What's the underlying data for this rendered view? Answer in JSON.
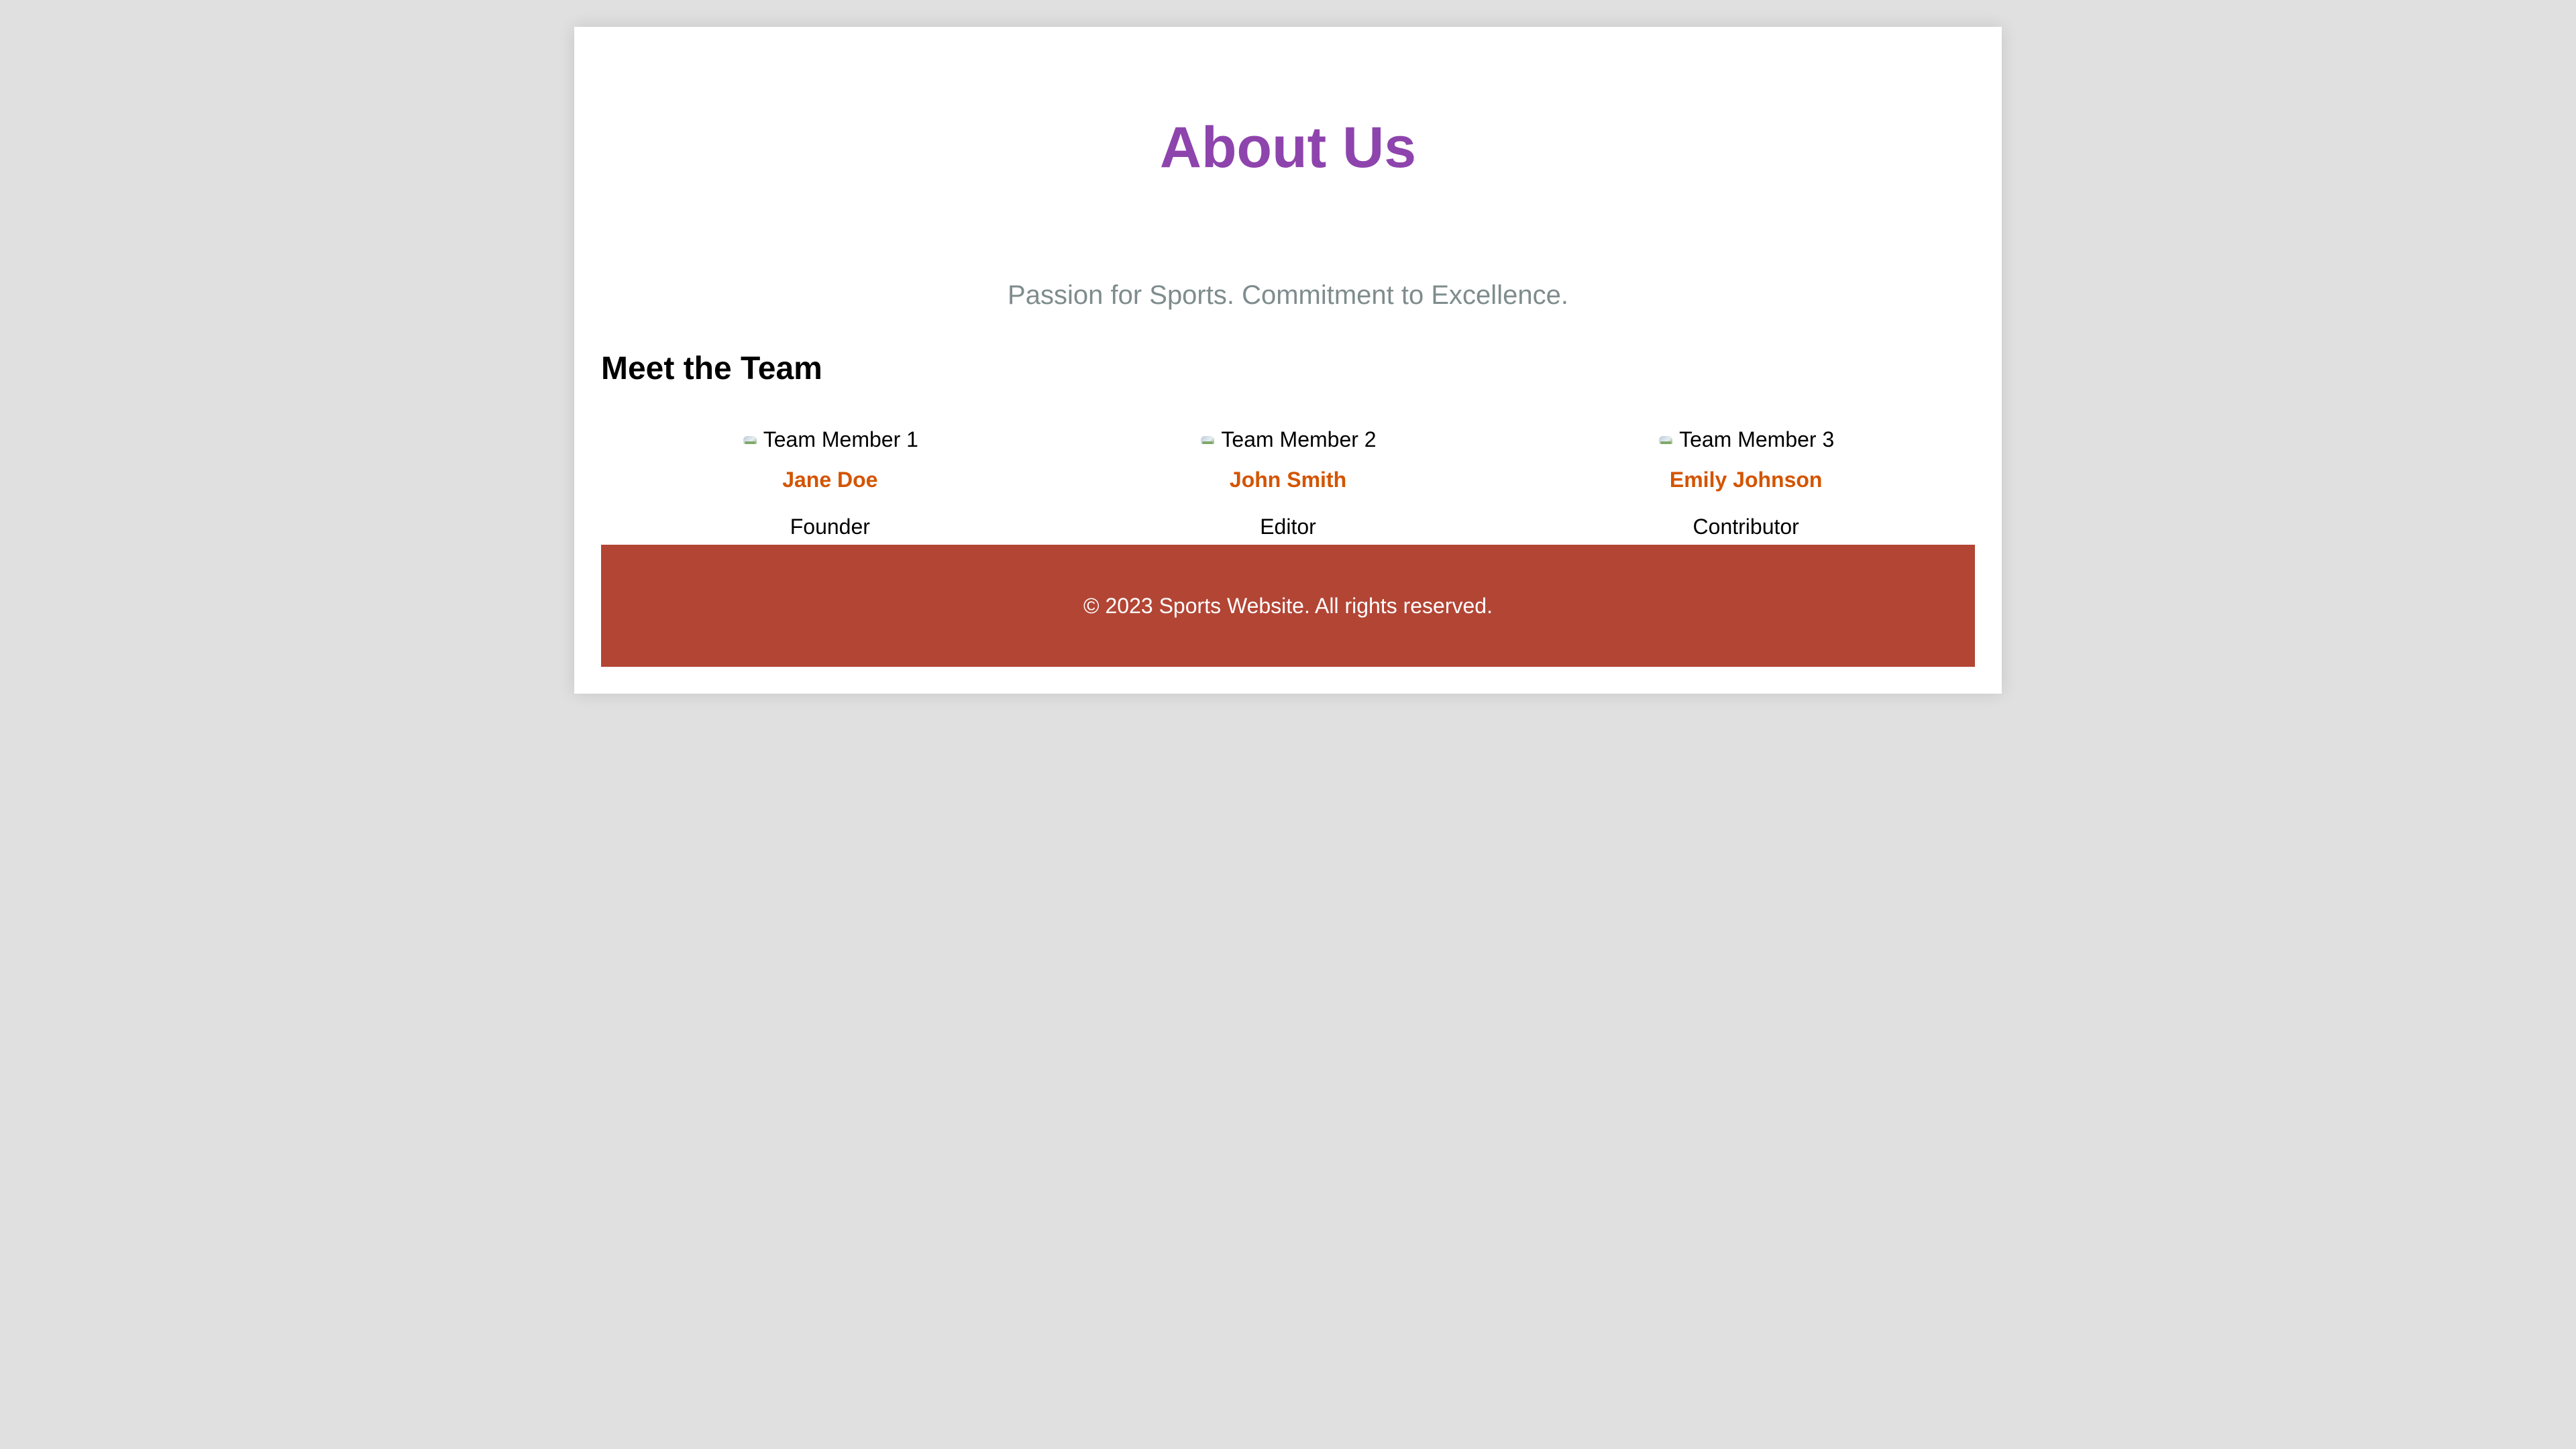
{
  "page": {
    "title": "About Us",
    "tagline": "Passion for Sports. Commitment to Excellence."
  },
  "team": {
    "heading": "Meet the Team",
    "members": [
      {
        "photo_alt": "Team Member 1",
        "photo_tail": "’",
        "name": "Jane Doe",
        "role": "Founder"
      },
      {
        "photo_alt": "Team Member 2",
        "photo_tail": "↗",
        "name": "John Smith",
        "role": "Editor"
      },
      {
        "photo_alt": "Team Member 3",
        "photo_tail": "↘",
        "name": "Emily Johnson",
        "role": "Contributor"
      }
    ]
  },
  "footer": {
    "text": "© 2023 Sports Website. All rights reserved."
  },
  "colors": {
    "page_background": "#e0e0e0",
    "title": "#8e44ad",
    "tagline": "#7f8c8d",
    "member_name": "#d35400",
    "footer_background": "#b34535"
  }
}
